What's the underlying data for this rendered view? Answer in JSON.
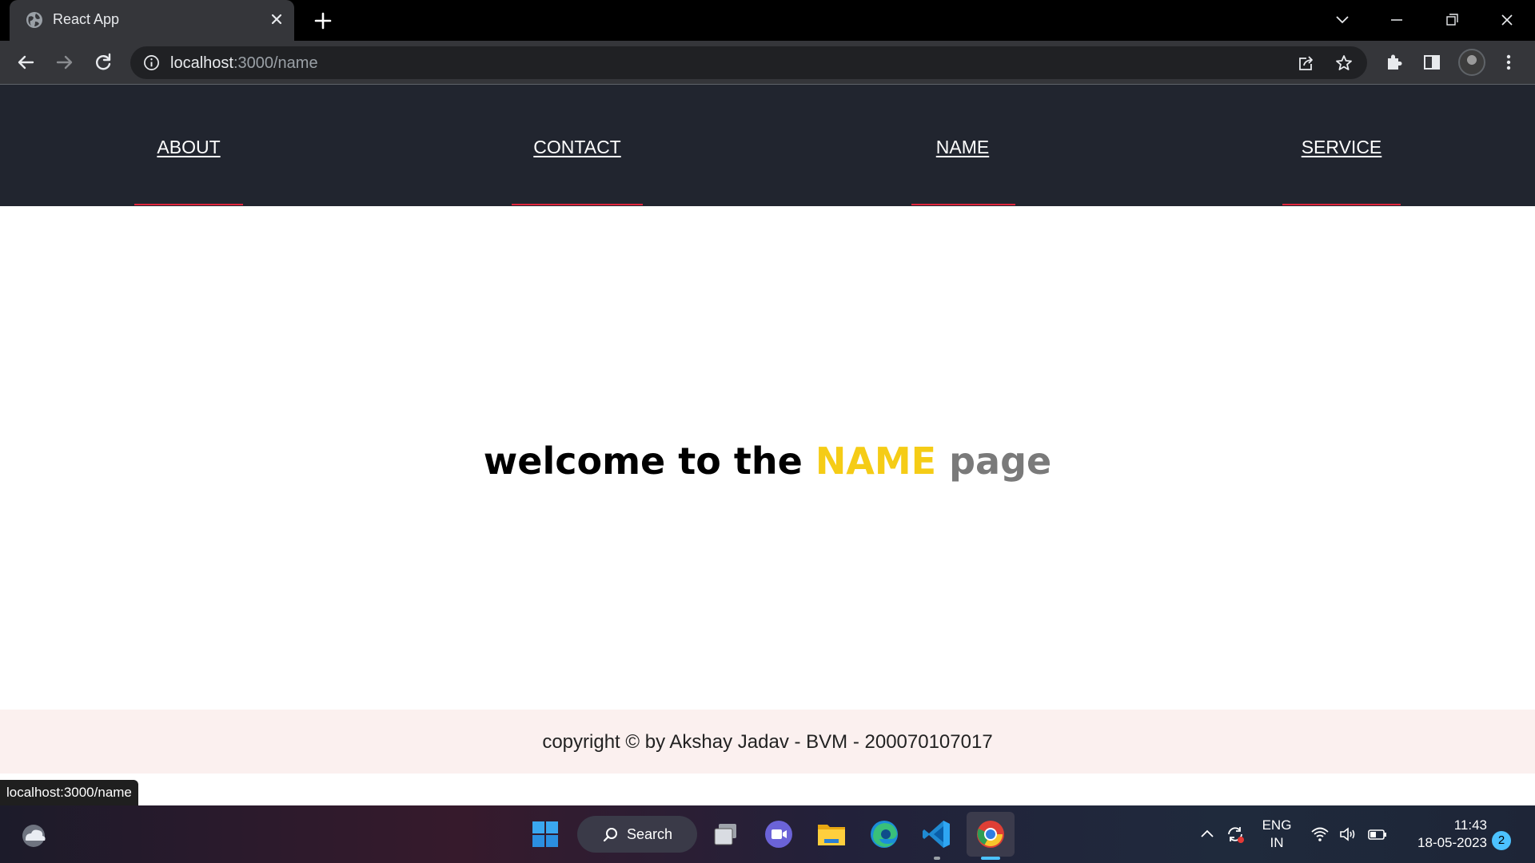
{
  "browser": {
    "tab_title": "React App",
    "url_host": "localhost",
    "url_path": ":3000/name",
    "status_url": "localhost:3000/name"
  },
  "nav": {
    "items": [
      {
        "label": "ABOUT"
      },
      {
        "label": "CONTACT"
      },
      {
        "label": "NAME"
      },
      {
        "label": "SERVICE"
      }
    ],
    "accent_color": "#e0253c",
    "background": "#21252f"
  },
  "main": {
    "welcome_prefix": "welcome to the",
    "welcome_highlight": "NAME",
    "welcome_suffix": "page",
    "highlight_color": "#f5cc16",
    "suffix_color": "#7a7a7a"
  },
  "footer": {
    "text": "copyright © by Akshay Jadav - BVM - 200070107017"
  },
  "taskbar": {
    "search_label": "Search",
    "language_line1": "ENG",
    "language_line2": "IN",
    "time": "11:43",
    "date": "18-05-2023",
    "notification_count": "2",
    "apps": [
      "weather-icon",
      "windows-start-icon",
      "search-icon",
      "task-view-icon",
      "chat-icon",
      "file-explorer-icon",
      "edge-icon",
      "vscode-icon",
      "chrome-icon"
    ]
  }
}
